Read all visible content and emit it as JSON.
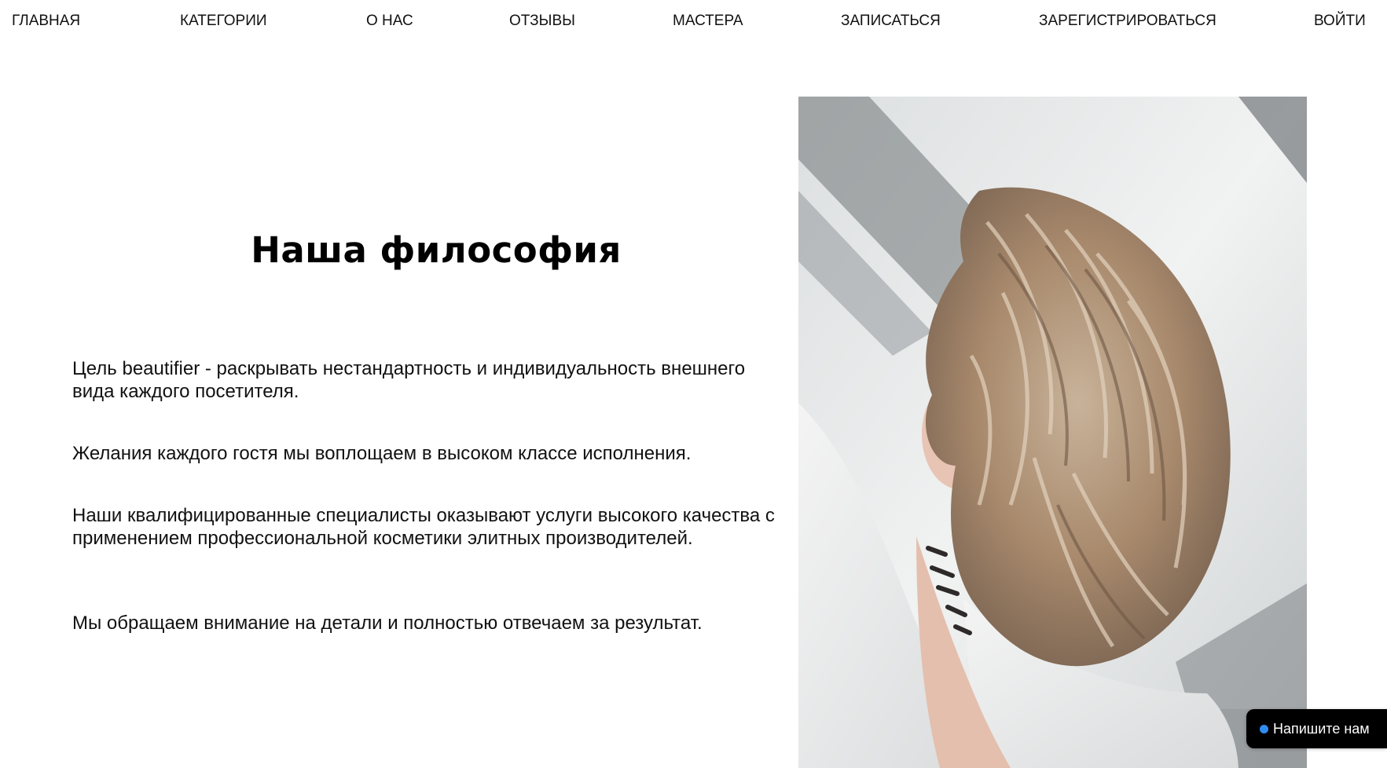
{
  "nav": {
    "items": [
      {
        "label": "ГЛАВНАЯ"
      },
      {
        "label": "КАТЕГОРИИ"
      },
      {
        "label": "О НАС"
      },
      {
        "label": "ОТЗЫВЫ"
      },
      {
        "label": "МАСТЕРА"
      },
      {
        "label": "ЗАПИСАТЬСЯ"
      },
      {
        "label": "ЗАРЕГИСТРИРОВАТЬСЯ"
      },
      {
        "label": "ВОЙТИ"
      }
    ]
  },
  "philosophy": {
    "title": "Наша философия",
    "paragraphs": [
      "Цель beautifier - раскрывать нестандартность и индивидуальность внешнего вида каждого посетителя.",
      "Желания каждого гостя мы воплощаем в высоком классе исполнения.",
      "Наши квалифицированные специалисты оказывают услуги высокого качества с применением профессиональной косметики элитных производителей.",
      "Мы обращаем внимание на детали и полностью отвечаем за результат."
    ]
  },
  "photo": {
    "icon": "hair-photo"
  },
  "chat": {
    "label": "Напишите нам",
    "dot_color": "#2f8df0"
  },
  "colors": {
    "text": "#111111",
    "background": "#ffffff",
    "widget_bg": "#000000"
  }
}
